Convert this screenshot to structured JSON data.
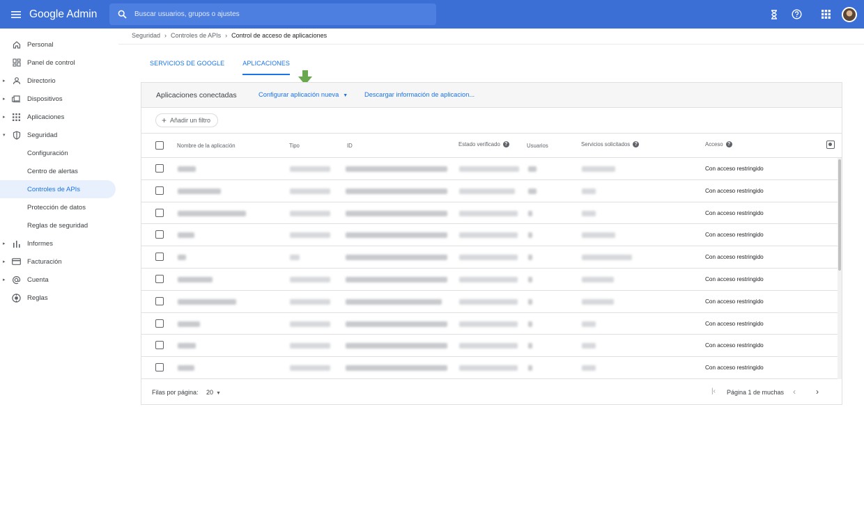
{
  "topbar": {
    "brand": "Google Admin",
    "search_placeholder": "Buscar usuarios, grupos o ajustes",
    "icons": [
      "hourglass-icon",
      "help-icon",
      "apps-grid-icon",
      "account-avatar"
    ]
  },
  "sidebar": {
    "items": [
      {
        "label": "Personal",
        "icon": "home-icon",
        "expandable": false
      },
      {
        "label": "Panel de control",
        "icon": "dashboard-icon",
        "expandable": false
      },
      {
        "label": "Directorio",
        "icon": "person-icon",
        "expandable": true
      },
      {
        "label": "Dispositivos",
        "icon": "devices-icon",
        "expandable": true
      },
      {
        "label": "Aplicaciones",
        "icon": "apps-icon",
        "expandable": true
      },
      {
        "label": "Seguridad",
        "icon": "shield-icon",
        "expandable": true,
        "expanded": true
      },
      {
        "label": "Configuración",
        "sub": true
      },
      {
        "label": "Centro de alertas",
        "sub": true
      },
      {
        "label": "Controles de APIs",
        "sub": true,
        "active": true
      },
      {
        "label": "Protección de datos",
        "sub": true
      },
      {
        "label": "Reglas de seguridad",
        "sub": true
      },
      {
        "label": "Informes",
        "icon": "bar-chart-icon",
        "expandable": true
      },
      {
        "label": "Facturación",
        "icon": "credit-card-icon",
        "expandable": true
      },
      {
        "label": "Cuenta",
        "icon": "at-sign-icon",
        "expandable": true
      },
      {
        "label": "Reglas",
        "icon": "rules-icon",
        "expandable": false
      }
    ]
  },
  "breadcrumb": {
    "items": [
      "Seguridad",
      "Controles de APIs",
      "Control de acceso de aplicaciones"
    ]
  },
  "tabs": [
    {
      "label": "SERVICIOS DE GOOGLE",
      "active": false
    },
    {
      "label": "APLICACIONES",
      "active": true
    }
  ],
  "card": {
    "title": "Aplicaciones conectadas",
    "configure_link": "Configurar aplicación nueva",
    "download_link": "Descargar información de aplicacion...",
    "filter_label": "Añadir un filtro"
  },
  "table": {
    "headers": {
      "name": "Nombre de la aplicación",
      "type": "Tipo",
      "id": "ID",
      "verified": "Estado verificado",
      "users": "Usuarios",
      "services": "Servicios solicitados",
      "access": "Acceso"
    },
    "rows": [
      {
        "access": "Con acceso restringido"
      },
      {
        "access": "Con acceso restringido"
      },
      {
        "access": "Con acceso restringido"
      },
      {
        "access": "Con acceso restringido"
      },
      {
        "access": "Con acceso restringido"
      },
      {
        "access": "Con acceso restringido"
      },
      {
        "access": "Con acceso restringido"
      },
      {
        "access": "Con acceso restringido"
      },
      {
        "access": "Con acceso restringido"
      },
      {
        "access": "Con acceso restringido"
      }
    ]
  },
  "pager": {
    "rows_per_page_label": "Filas por página:",
    "rows_per_page_value": "20",
    "page_info": "Página 1 de muchas"
  },
  "colors": {
    "topbar": "#3b6fd6",
    "accent": "#1a73e8",
    "arrow": "#6aa84f"
  }
}
